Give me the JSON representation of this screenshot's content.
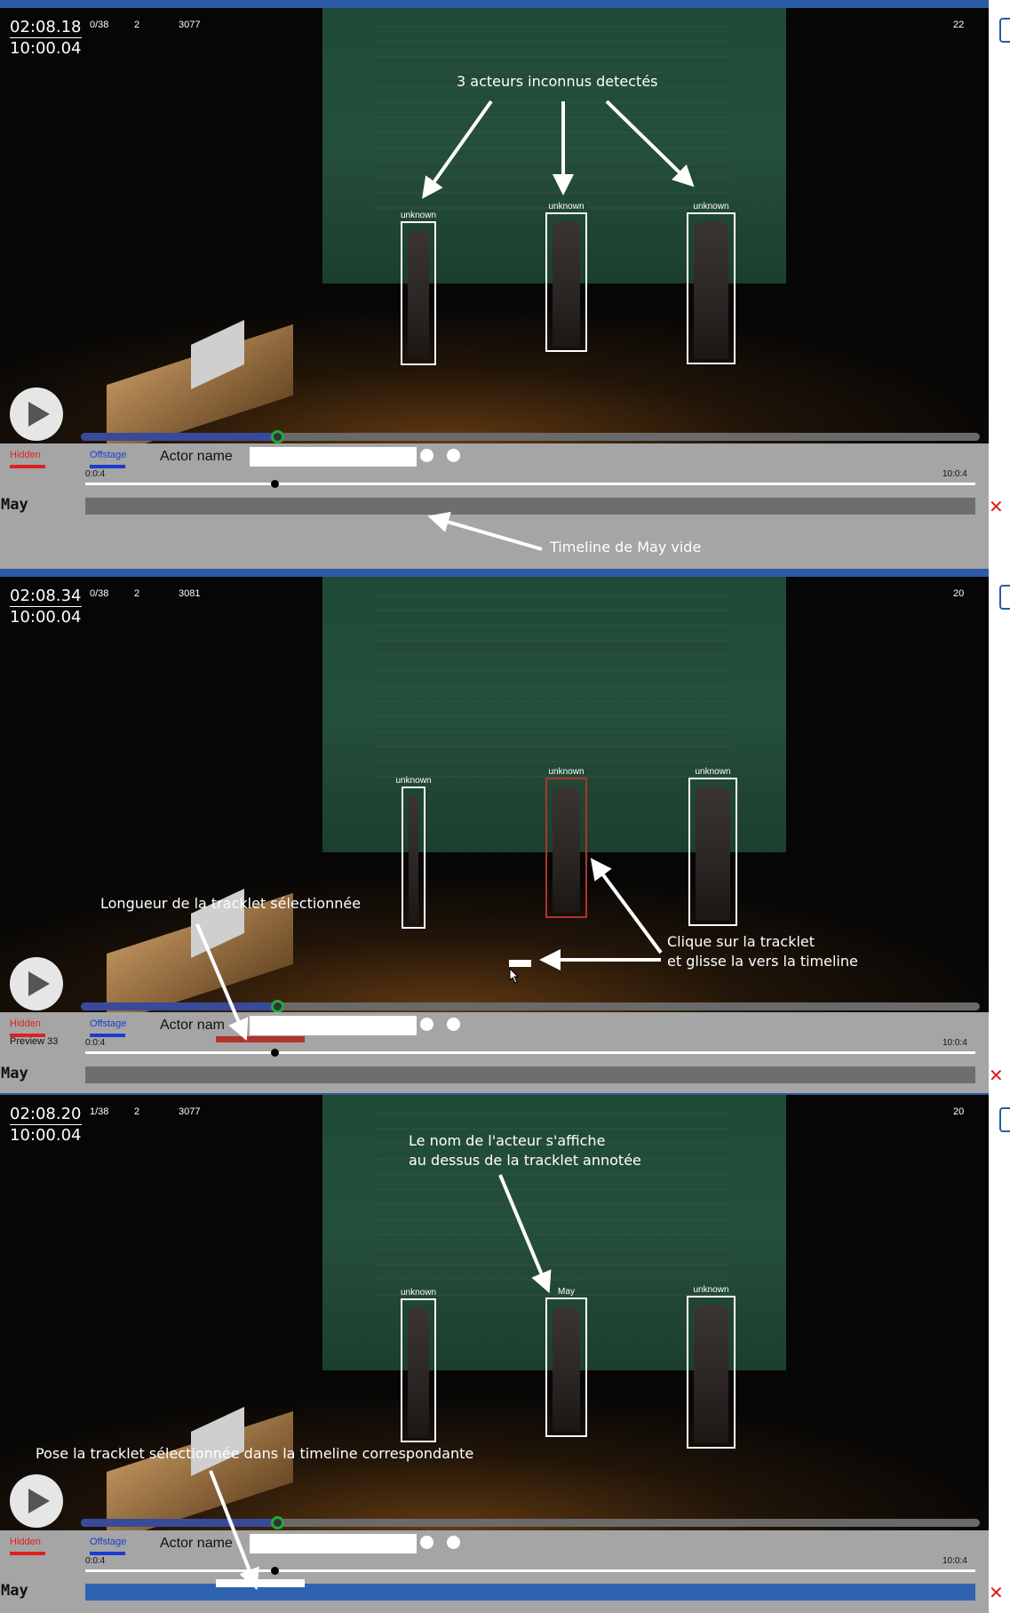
{
  "annotation_ui": {
    "hidden_label": "Hidden",
    "offstage_label": "Offstage",
    "actor_name_label": "Actor name",
    "actor_name_label_partial": "Actor nam",
    "actor_name_value": "",
    "time_start": "0:0:4",
    "time_end": "10:0:4",
    "actor_row_name": "May",
    "delete_symbol": "✕",
    "colors": {
      "hidden": "#e02020",
      "offstage": "#1a3cd0",
      "selected_tracklet": "#b0332c",
      "filled_timeline": "#2f63b0",
      "topbar": "#2b5aa6"
    }
  },
  "panels": [
    {
      "current_time": "02:08.18",
      "duration": "10:00.04",
      "counter": "0/38",
      "tracks": "2",
      "frame": "3077",
      "right_value": "22",
      "boxes": [
        {
          "label": "unknown"
        },
        {
          "label": "unknown"
        },
        {
          "label": "unknown"
        }
      ],
      "notes": {
        "top": "3  acteurs inconnus detectés",
        "timeline": "Timeline de May vide"
      }
    },
    {
      "current_time": "02:08.34",
      "duration": "10:00.04",
      "counter": "0/38",
      "tracks": "2",
      "frame": "3081",
      "right_value": "20",
      "preview": "Preview 33",
      "boxes": [
        {
          "label": "unknown"
        },
        {
          "label": "unknown"
        },
        {
          "label": "unknown"
        }
      ],
      "notes": {
        "length": "Longueur de la tracklet sélectionnée",
        "drag_line1": "Clique sur la tracklet",
        "drag_line2": "et glisse la vers la timeline"
      }
    },
    {
      "current_time": "02:08.20",
      "duration": "10:00.04",
      "counter": "1/38",
      "tracks": "2",
      "frame": "3077",
      "right_value": "20",
      "boxes": [
        {
          "label": "unknown"
        },
        {
          "label": "May"
        },
        {
          "label": "unknown"
        }
      ],
      "notes": {
        "name_line1": "Le nom de l'acteur s'affiche",
        "name_line2": "au dessus de la tracklet annotée",
        "place": "Pose la tracklet sélectionnée dans la timeline correspondante"
      }
    }
  ]
}
